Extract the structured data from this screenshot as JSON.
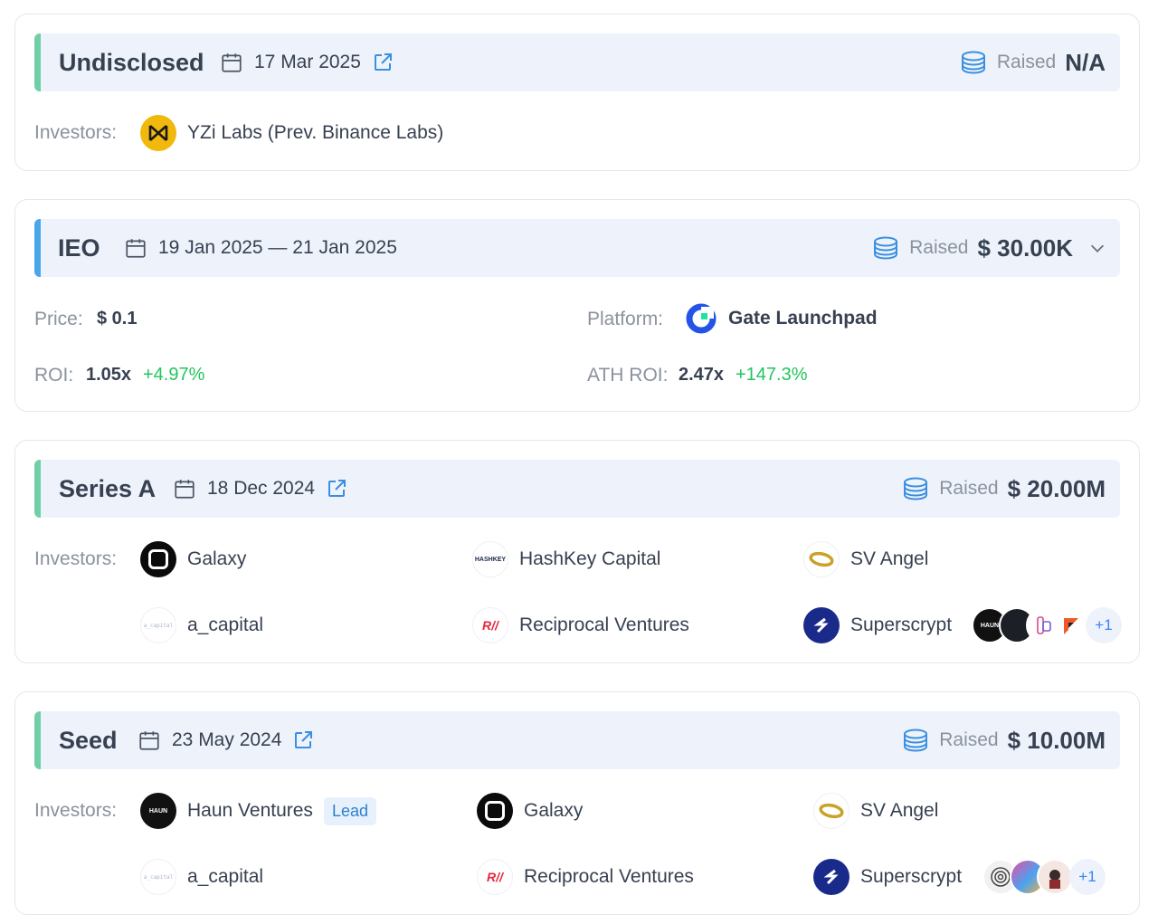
{
  "rounds": [
    {
      "name": "Undisclosed",
      "date": "17 Mar 2025",
      "raised_label": "Raised",
      "raised_value": "N/A",
      "investors_label": "Investors:",
      "investors": [
        "YZi Labs (Prev. Binance Labs)"
      ]
    },
    {
      "name": "IEO",
      "date": "19 Jan 2025 — 21 Jan 2025",
      "raised_label": "Raised",
      "raised_value": "$ 30.00K",
      "price_label": "Price:",
      "price_value": "$ 0.1",
      "platform_label": "Platform:",
      "platform_value": "Gate Launchpad",
      "roi_label": "ROI:",
      "roi_value": "1.05x",
      "roi_change": "+4.97%",
      "ath_roi_label": "ATH ROI:",
      "ath_roi_value": "2.47x",
      "ath_roi_change": "+147.3%"
    },
    {
      "name": "Series A",
      "date": "18 Dec 2024",
      "raised_label": "Raised",
      "raised_value": "$ 20.00M",
      "investors_label": "Investors:",
      "investors": [
        "Galaxy",
        "HashKey Capital",
        "SV Angel",
        "a_capital",
        "Reciprocal Ventures",
        "Superscrypt"
      ],
      "more_count": "+1",
      "logo_texts": {
        "hashkey": "HASHKEY",
        "a_capital": "a_capital",
        "haun": "HAUN",
        "reciprocal": "R//"
      }
    },
    {
      "name": "Seed",
      "date": "23 May 2024",
      "raised_label": "Raised",
      "raised_value": "$ 10.00M",
      "investors_label": "Investors:",
      "investors": [
        "Haun Ventures",
        "Galaxy",
        "SV Angel",
        "a_capital",
        "Reciprocal Ventures",
        "Superscrypt"
      ],
      "lead_badge": "Lead",
      "more_count": "+1",
      "logo_texts": {
        "haun": "HAUN",
        "a_capital": "a_capital",
        "reciprocal": "R//"
      }
    }
  ],
  "colors": {
    "accent_green": "#6fd0a8",
    "accent_blue": "#4aa6e8",
    "positive": "#22c55e",
    "link": "#2f80d1"
  }
}
